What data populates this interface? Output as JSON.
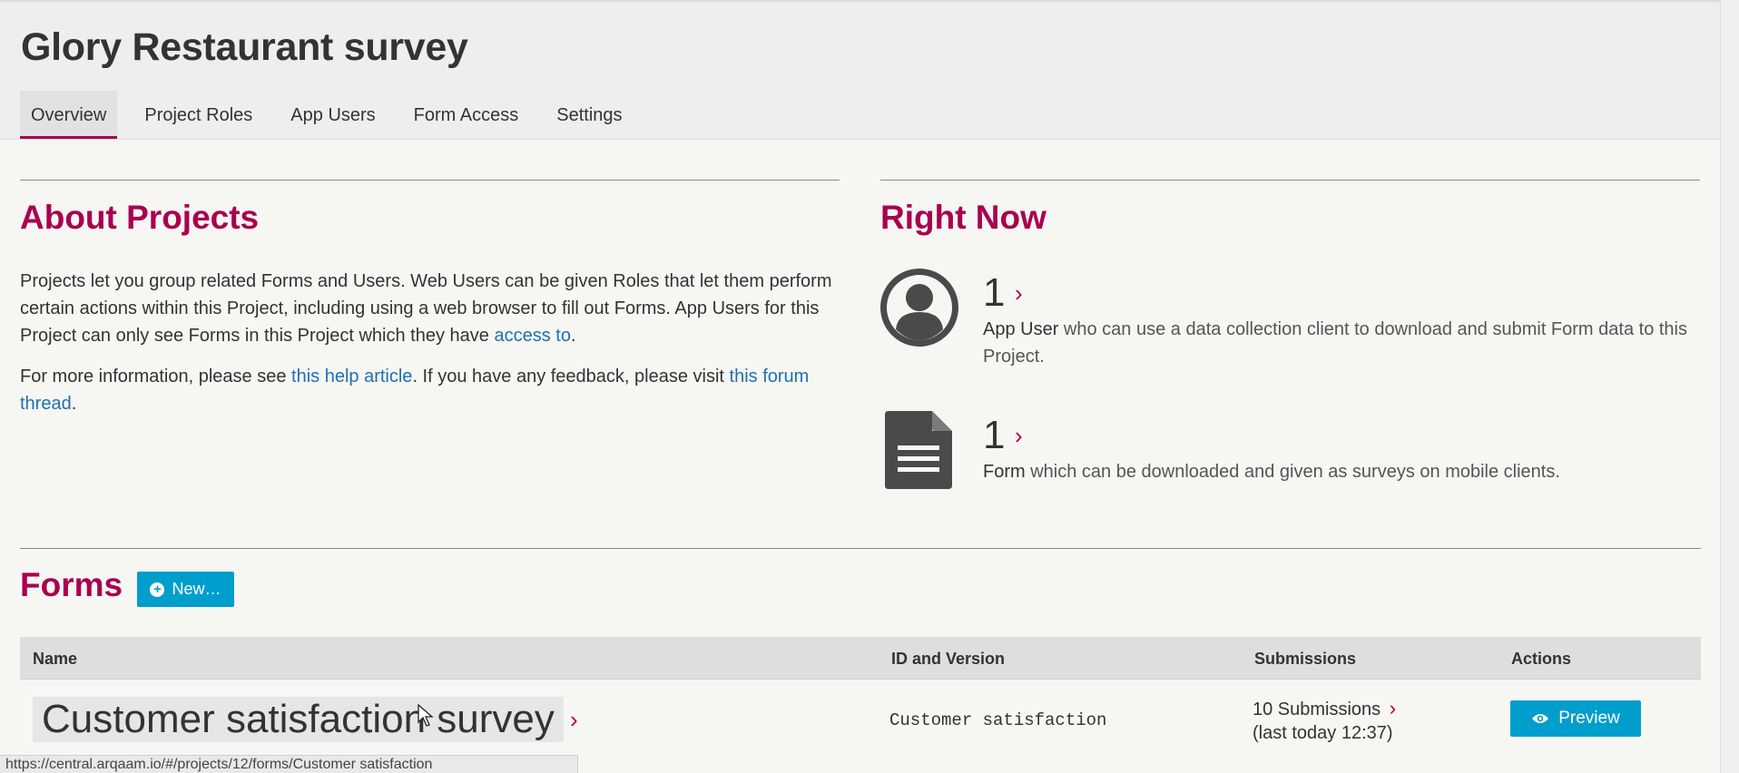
{
  "page": {
    "title": "Glory Restaurant survey"
  },
  "tabs": [
    {
      "label": "Overview",
      "active": true
    },
    {
      "label": "Project Roles",
      "active": false
    },
    {
      "label": "App Users",
      "active": false
    },
    {
      "label": "Form Access",
      "active": false
    },
    {
      "label": "Settings",
      "active": false
    }
  ],
  "about": {
    "heading": "About Projects",
    "p1_text": "Projects let you group related Forms and Users. Web Users can be given Roles that let them perform certain actions within this Project, including using a web browser to fill out Forms. App Users for this Project can only see Forms in this Project which they have ",
    "p1_link": "access to",
    "p1_end": ".",
    "p2_start": "For more information, please see ",
    "p2_link1": "this help article",
    "p2_mid": ". If you have any feedback, please visit ",
    "p2_link2": "this forum thread",
    "p2_end": "."
  },
  "right_now": {
    "heading": "Right Now",
    "app_users": {
      "count": "1",
      "label": "App User",
      "desc": " who can use a data collection client to download and submit Form data to this Project.",
      "icon": "user-icon"
    },
    "forms": {
      "count": "1",
      "label": "Form",
      "desc": " which can be downloaded and given as surveys on mobile clients.",
      "icon": "document-icon"
    }
  },
  "forms_section": {
    "heading": "Forms",
    "new_label": "New…",
    "columns": [
      "Name",
      "ID and Version",
      "Submissions",
      "Actions"
    ],
    "rows": [
      {
        "name": "Customer satisfaction survey",
        "id": "Customer satisfaction",
        "submissions": "10 Submissions",
        "last": "(last today 12:37)",
        "action": "Preview"
      }
    ]
  },
  "status_bar": {
    "url": "https://central.arqaam.io/#/projects/12/forms/Customer satisfaction"
  },
  "colors": {
    "accent": "#a9004f",
    "button": "#009ecc",
    "link": "#1f70b3"
  }
}
